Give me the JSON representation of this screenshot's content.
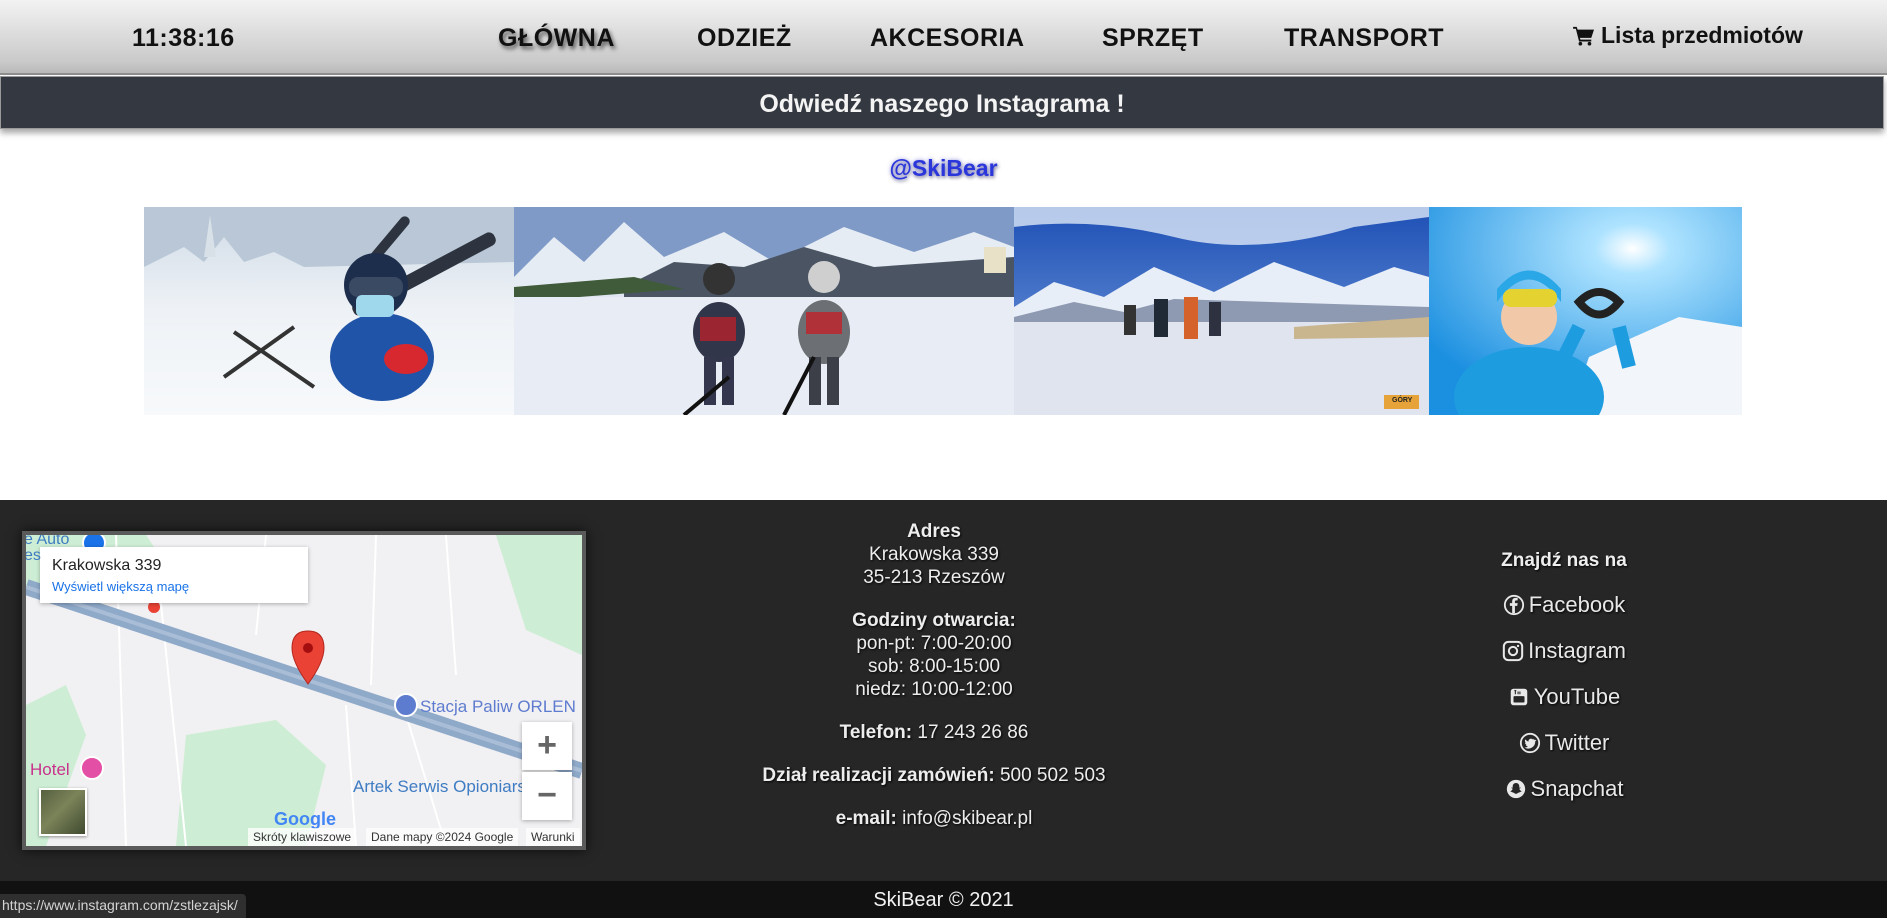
{
  "nav": {
    "clock": "11:38:16",
    "items": [
      {
        "label": "GŁÓWNA",
        "active": true
      },
      {
        "label": "ODZIEŻ",
        "active": false
      },
      {
        "label": "AKCESORIA",
        "active": false
      },
      {
        "label": "SPRZĘT",
        "active": false
      },
      {
        "label": "TRANSPORT",
        "active": false
      }
    ],
    "cart_label": "Lista przedmiotów",
    "cart_icon": "shopping-cart-icon"
  },
  "banner": {
    "title": "Odwiedź naszego Instagrama !",
    "handle": "@SkiBear"
  },
  "gallery": {
    "photos": [
      {
        "name": "child-lying-in-snow-photo"
      },
      {
        "name": "two-kids-on-skis-photo"
      },
      {
        "name": "skiers-on-mountain-slope-photo",
        "watermark": "GÓRY"
      },
      {
        "name": "woman-heart-hands-photo"
      }
    ]
  },
  "map": {
    "card_address": "Krakowska 339",
    "card_link": "Wyświetl większą mapę",
    "labels": {
      "gas_station": "Stacja Paliw ORLEN",
      "service": "Artek Serwis Opioniarski",
      "hotel": "Hotel",
      "auto": "e Auto",
      "auto2": "es"
    },
    "zoom_in": "+",
    "zoom_out": "−",
    "logo": "Google",
    "attribution": {
      "shortcuts": "Skróty klawiszowe",
      "data": "Dane mapy ©2024 Google",
      "terms": "Warunki"
    },
    "colors": {
      "road": "#8fa9c9",
      "green": "#cdeed4",
      "pin": "#ea4335",
      "gas": "#5e7ccf",
      "hotel": "#e24fa5"
    }
  },
  "contact": {
    "address_label": "Adres",
    "address_line1": "Krakowska 339",
    "address_line2": "35-213 Rzeszów",
    "hours_label": "Godziny otwarcia:",
    "hours_weekday": "pon-pt: 7:00-20:00",
    "hours_saturday": "sob: 8:00-15:00",
    "hours_sunday": "niedz: 10:00-12:00",
    "phone_label": "Telefon:",
    "phone": "17 243 26 86",
    "orders_label": "Dział realizacji zamówień:",
    "orders_phone": "500 502 503",
    "email_label": "e-mail:",
    "email": "info@skibear.pl"
  },
  "social": {
    "title": "Znajdź nas na",
    "links": [
      {
        "label": "Facebook",
        "icon": "facebook-icon"
      },
      {
        "label": "Instagram",
        "icon": "instagram-icon"
      },
      {
        "label": "YouTube",
        "icon": "youtube-icon"
      },
      {
        "label": "Twitter",
        "icon": "twitter-icon"
      },
      {
        "label": "Snapchat",
        "icon": "snapchat-icon"
      }
    ]
  },
  "footer": {
    "copyright": "SkiBear © 2021"
  },
  "status_bar": {
    "url": "https://www.instagram.com/zstlezajsk/"
  }
}
